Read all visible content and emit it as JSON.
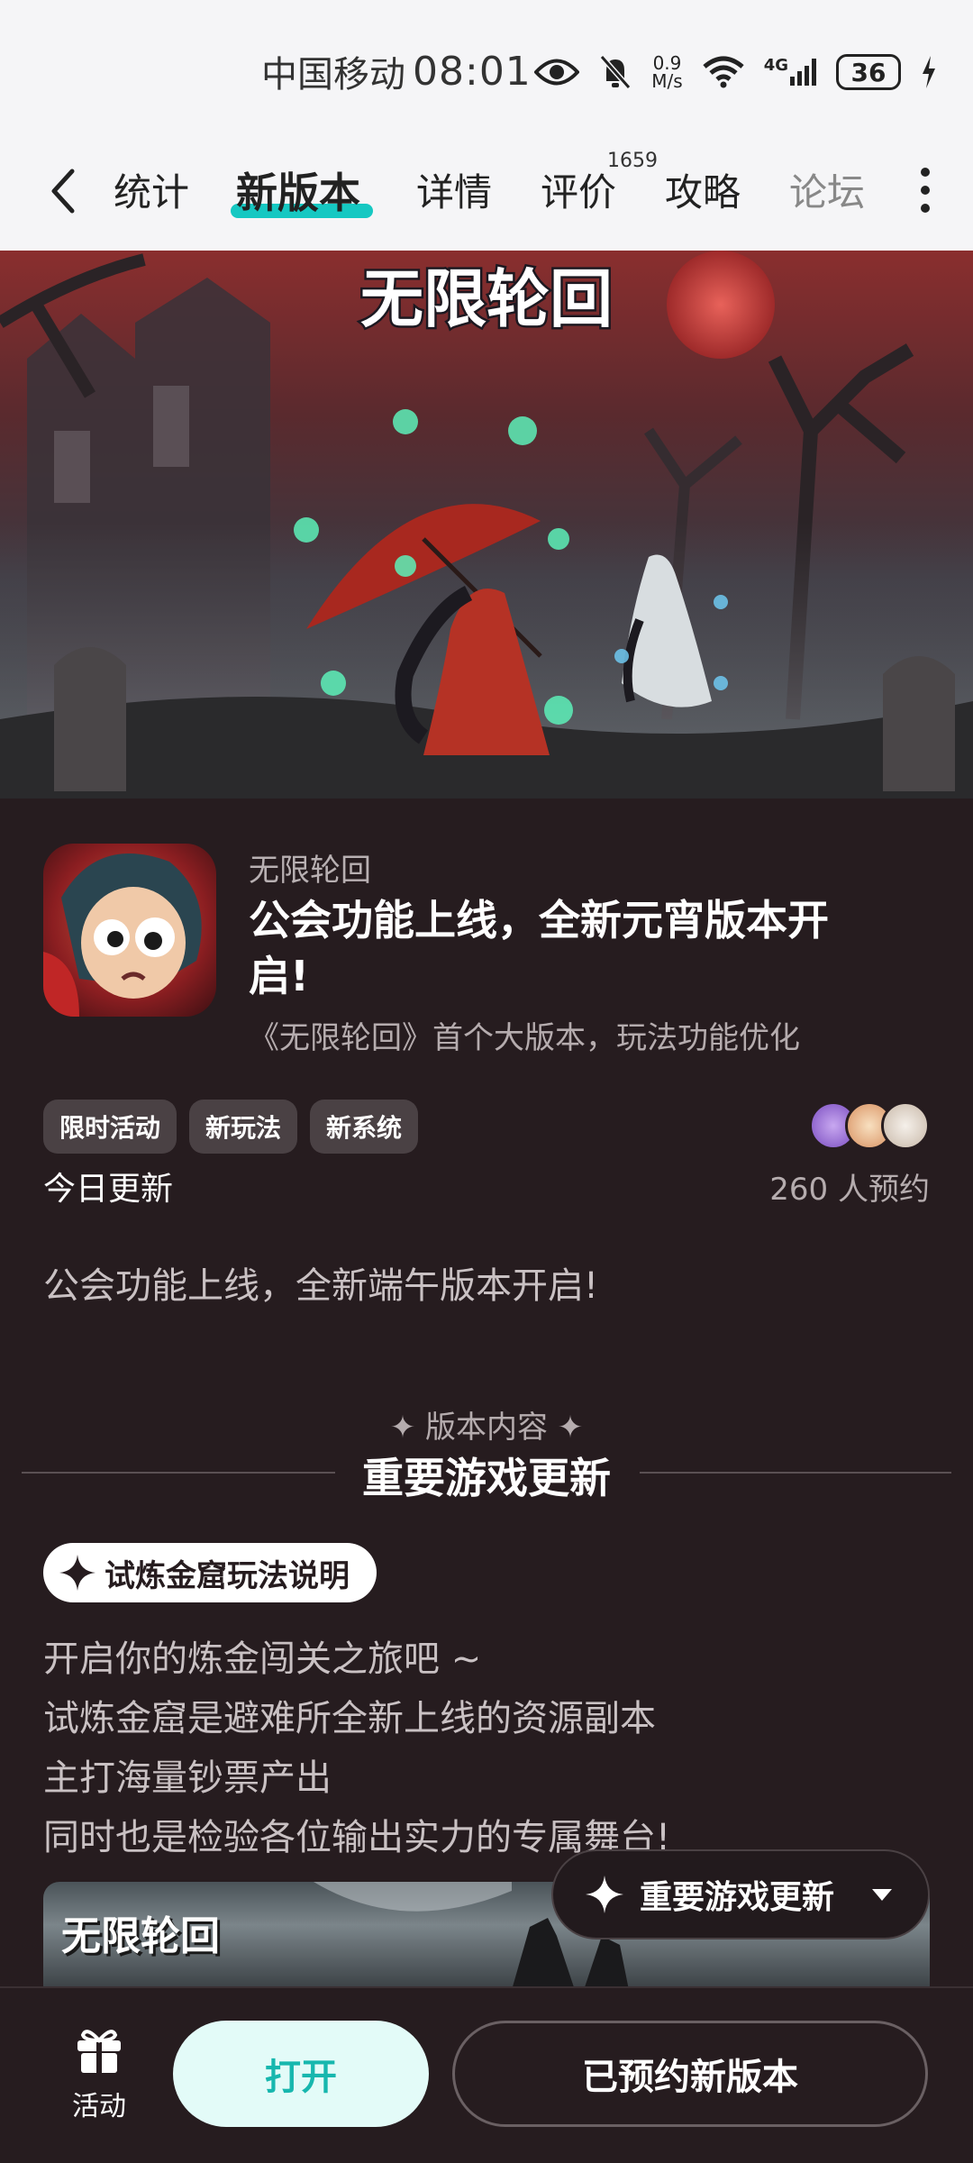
{
  "status_bar": {
    "carrier": "中国移动",
    "time": "08:01",
    "net_speed_value": "0.9",
    "net_speed_unit": "M/s",
    "network_type": "4G",
    "battery": "36"
  },
  "nav": {
    "tabs": [
      {
        "label": "统计"
      },
      {
        "label": "新版本"
      },
      {
        "label": "详情"
      },
      {
        "label": "评价"
      },
      {
        "label": "攻略"
      },
      {
        "label": "论坛"
      }
    ],
    "review_count": "1659",
    "active_tab": "新版本"
  },
  "hero": {
    "logo_text": "无限轮回"
  },
  "app": {
    "name": "无限轮回",
    "headline": "公会功能上线，全新元宵版本开启!",
    "subhead": "《无限轮回》首个大版本，玩法功能优化",
    "tags": [
      "限时活动",
      "新玩法",
      "新系统"
    ],
    "update_status": "今日更新",
    "reserve_count": "260 人预约",
    "description": "公会功能上线，全新端午版本开启!"
  },
  "section": {
    "kicker": "✦ 版本内容 ✦",
    "title": "重要游戏更新"
  },
  "subsection": {
    "pill_label": "试炼金窟玩法说明",
    "lines": [
      "开启你的炼金闯关之旅吧 ~",
      "试炼金窟是避难所全新上线的资源副本",
      "主打海量钞票产出",
      "同时也是检验各位输出实力的专属舞台!"
    ]
  },
  "content_image": {
    "logo_text": "无限轮回"
  },
  "floating_chip": {
    "label": "重要游戏更新"
  },
  "bottom_bar": {
    "activity_label": "活动",
    "open_label": "打开",
    "reserved_label": "已预约新版本"
  },
  "colors": {
    "accent": "#16c8c2",
    "background": "#261c1f",
    "open_button_bg": "#e3fbf8",
    "open_button_text": "#17b7ae"
  }
}
